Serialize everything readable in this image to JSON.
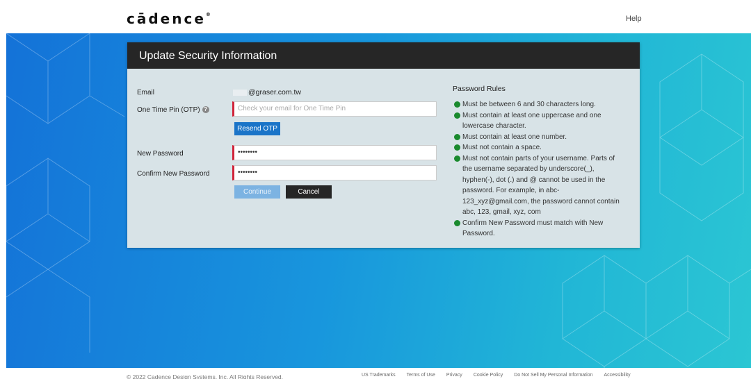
{
  "header": {
    "logo": "cādence",
    "logo_mark": "®",
    "help_label": "Help"
  },
  "card": {
    "title": "Update Security Information",
    "email_label": "Email",
    "email_value": "@graser.com.tw",
    "otp_label": "One Time Pin (OTP)",
    "otp_placeholder": "Check your email for One Time Pin",
    "resend_label": "Resend OTP",
    "new_password_label": "New Password",
    "new_password_value": "••••••••",
    "confirm_password_label": "Confirm New Password",
    "confirm_password_value": "••••••••",
    "continue_label": "Continue",
    "cancel_label": "Cancel"
  },
  "rules": {
    "title": "Password Rules",
    "items": [
      "Must be between 6 and 30 characters long.",
      "Must contain at least one uppercase and one lowercase character.",
      "Must contain at least one number.",
      "Must not contain a space.",
      "Must not contain parts of your username. Parts of the username separated by underscore(_), hyphen(-), dot (.) and @ cannot be used in the password. For example, in abc-123_xyz@gmail.com, the password cannot contain abc, 123, gmail, xyz, com",
      "Confirm New Password must match with New Password."
    ]
  },
  "footer": {
    "copyright": "© 2022 Cadence Design Systems, Inc. All Rights Reserved.",
    "links": [
      "US Trademarks",
      "Terms of Use",
      "Privacy",
      "Cookie Policy",
      "Do Not Sell My Personal Information",
      "Accessibility"
    ]
  },
  "colors": {
    "accent": "#1a74c8",
    "header_dark": "#262626",
    "invalid_border": "#d0243a",
    "rule_dot": "#1a8a2e"
  }
}
